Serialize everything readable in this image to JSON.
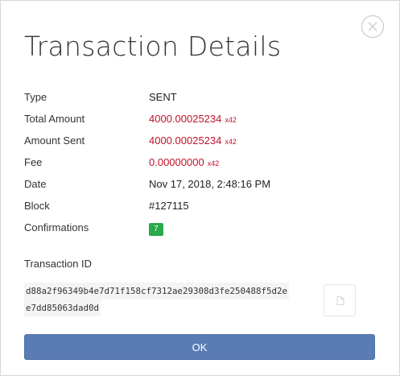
{
  "dialog": {
    "title": "Transaction Details",
    "close_icon": "close-circle-icon"
  },
  "details": {
    "type": {
      "label": "Type",
      "value": "SENT"
    },
    "total_amount": {
      "label": "Total Amount",
      "value": "4000.00025234",
      "currency": "x42"
    },
    "amount_sent": {
      "label": "Amount Sent",
      "value": "4000.00025234",
      "currency": "x42"
    },
    "fee": {
      "label": "Fee",
      "value": "0.00000000",
      "currency": "x42"
    },
    "date": {
      "label": "Date",
      "value": "Nov 17, 2018, 2:48:16 PM"
    },
    "block": {
      "label": "Block",
      "value": "#127115"
    },
    "confirmations": {
      "label": "Confirmations",
      "value": "7"
    }
  },
  "transaction_id": {
    "label": "Transaction ID",
    "line1": "d88a2f96349b4e7d71f158cf7312ae29308d3fe250488f5d2e",
    "line2": "e7dd85063dad0d",
    "copy_icon": "copy-icon"
  },
  "footer": {
    "ok_label": "OK"
  },
  "colors": {
    "amount_red": "#c0122b",
    "badge_green": "#2aa84a",
    "button_blue": "#5a7cb4"
  }
}
